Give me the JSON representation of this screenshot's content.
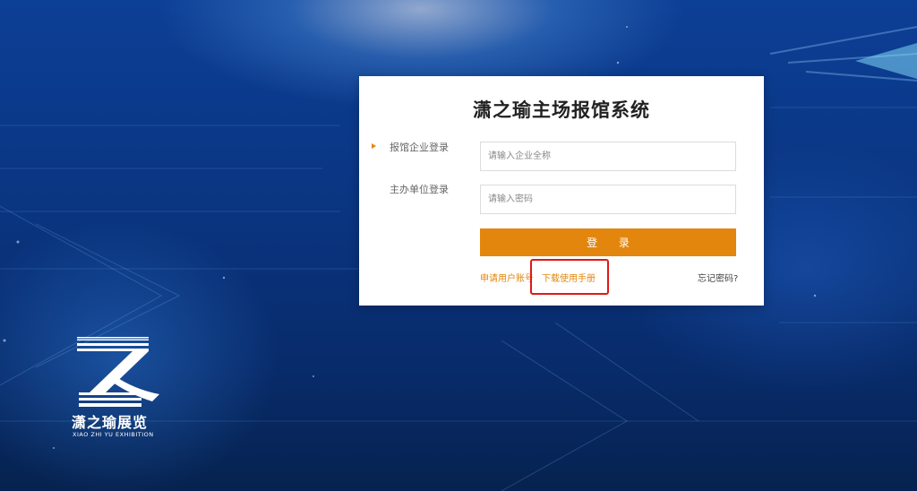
{
  "login": {
    "title": "潇之瑜主场报馆系统",
    "tabs": [
      {
        "label": "报馆企业登录",
        "active": true
      },
      {
        "label": "主办单位登录",
        "active": false
      }
    ],
    "company_field": {
      "placeholder": "请输入企业全称",
      "value": ""
    },
    "password_field": {
      "placeholder": "请输入密码",
      "value": ""
    },
    "login_button": "登 录",
    "apply_link": "申请用户账号",
    "manual_link": "下载使用手册",
    "forgot_link": "忘记密码?"
  },
  "brand": {
    "name": "潇之瑜展览",
    "subtitle": "XIAO ZHI YU EXHIBITION"
  },
  "colors": {
    "accent": "#e3860e",
    "highlight": "#e01818",
    "background": "#0a347f"
  }
}
